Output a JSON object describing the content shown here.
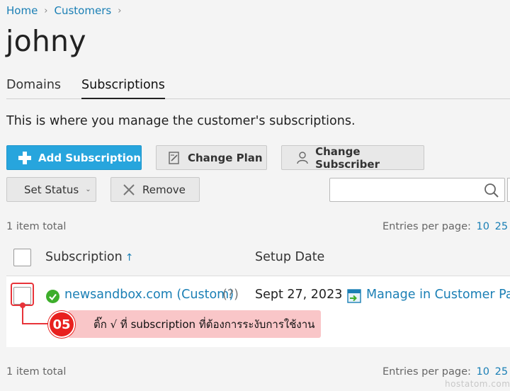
{
  "breadcrumb": {
    "items": [
      "Home",
      "Customers"
    ],
    "sep": "›"
  },
  "page_title": "johny",
  "tabs": [
    {
      "label": "Domains"
    },
    {
      "label": "Subscriptions"
    }
  ],
  "intro": "This is where you manage the customer's subscriptions.",
  "toolbar": {
    "add_subscription": "Add Subscription",
    "change_plan": "Change Plan",
    "change_subscriber": "Change Subscriber",
    "set_status": "Set Status",
    "remove": "Remove"
  },
  "search": {
    "placeholder": "",
    "value": ""
  },
  "list_summary": {
    "total": "1 item total",
    "entries_label": "Entries per page:",
    "page_sizes": [
      "10",
      "25",
      "10"
    ]
  },
  "table": {
    "columns": [
      "Subscription",
      "Setup Date"
    ],
    "sort_arrow": "↑",
    "rows": [
      {
        "subscription": "newsandbox.com (Custom)",
        "help": "(?)",
        "setup_date": "Sept 27, 2023",
        "manage": "Manage in Customer Panel"
      }
    ]
  },
  "annotation": {
    "step": "05",
    "text": "ติ๊ก √ ที่ subscription ที่ต้องการระงับการใช้งาน"
  },
  "watermark": "hostatom.com",
  "colors": {
    "primary": "#27a5dd",
    "link": "#1a7fb5",
    "highlight": "#e8343a",
    "callout_bg": "#f9c6c8",
    "status_ok": "#3dae2b"
  }
}
